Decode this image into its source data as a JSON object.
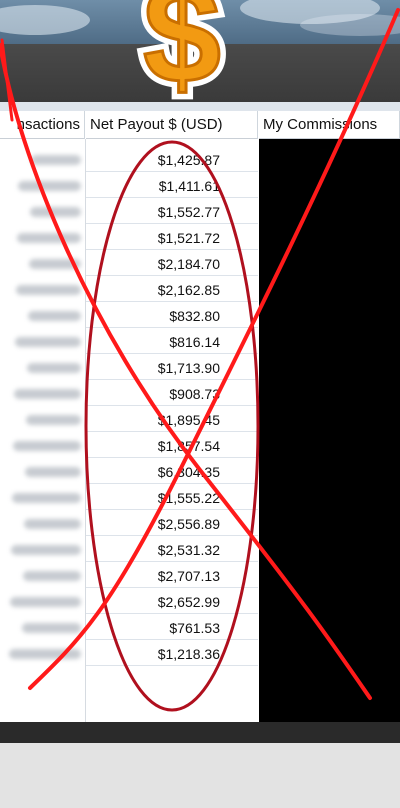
{
  "headers": {
    "transactions": "nsactions",
    "net_payout": "Net Payout $ (USD)",
    "my_commissions": "My Commissions"
  },
  "payouts": [
    "$1,425.87",
    "$1,411.61",
    "$1,552.77",
    "$1,521.72",
    "$2,184.70",
    "$2,162.85",
    "$832.80",
    "$816.14",
    "$1,713.90",
    "$908.73",
    "$1,895.45",
    "$1,857.54",
    "$6,304.35",
    "$1,555.22",
    "$2,556.89",
    "$2,531.32",
    "$2,707.13",
    "$2,652.99",
    "$761.53",
    "$1,218.36"
  ],
  "logo": {
    "symbol": "$"
  },
  "colors": {
    "annotation_red": "#ff1a1a",
    "ellipse_red": "#b0101e",
    "coin_orange": "#f29a12"
  }
}
